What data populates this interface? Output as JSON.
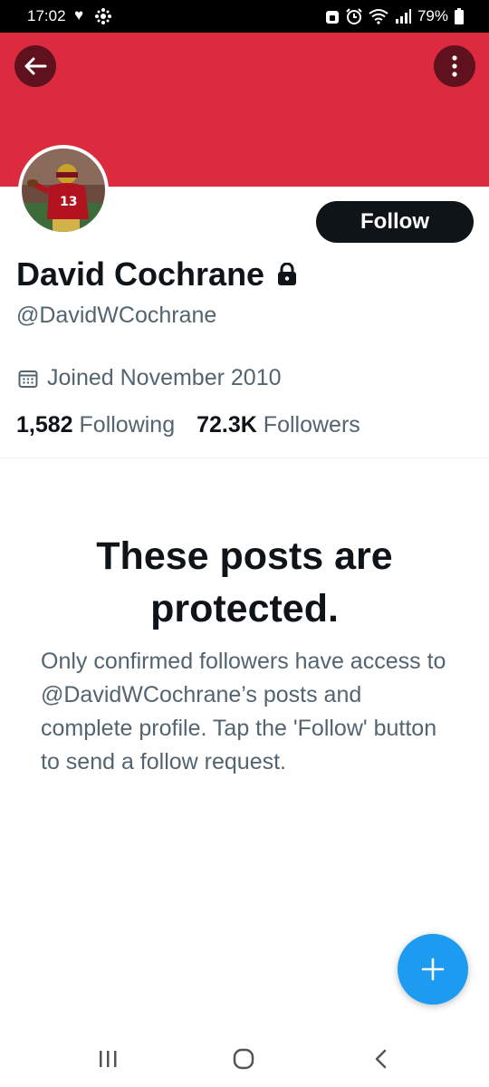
{
  "status_bar": {
    "time": "17:02",
    "battery": "79%",
    "icons": [
      "heart-icon",
      "cbc-gem-icon",
      "lock-status-icon",
      "alarm-icon",
      "wifi-icon",
      "signal-icon",
      "battery-icon"
    ]
  },
  "banner": {
    "color": "#dc2b3f"
  },
  "profile": {
    "display_name": "David Cochrane",
    "handle": "@DavidWCochrane",
    "joined": "Joined November 2010",
    "following_count": "1,582",
    "following_label": "Following",
    "followers_count": "72.3K",
    "followers_label": "Followers",
    "follow_button": "Follow"
  },
  "protected": {
    "title": "These posts are protected.",
    "body": "Only confirmed followers have access to @DavidWCochrane’s posts and complete profile. Tap the 'Follow' button to send a follow request."
  },
  "colors": {
    "accent": "#1d9bf0",
    "text": "#0f1419",
    "secondary": "#536471"
  },
  "fab": {
    "icon": "plus-icon"
  },
  "nav": {
    "icons": [
      "recent-apps-icon",
      "home-icon",
      "back-nav-icon"
    ]
  }
}
